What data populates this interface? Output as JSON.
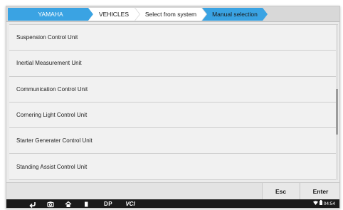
{
  "breadcrumb": {
    "items": [
      "YAMAHA",
      "VEHICLES",
      "Select from system",
      "Manual selection"
    ]
  },
  "list": {
    "items": [
      "Suspension Control Unit",
      "Inertial Measurement Unit",
      "Communication Control Unit",
      "Cornering Light Control Unit",
      "Starter Generater Control Unit",
      "Standing Assist Control Unit"
    ]
  },
  "actions": {
    "esc_label": "Esc",
    "enter_label": "Enter"
  },
  "navbar": {
    "dp_label": "DP",
    "vci_label": "VCI",
    "back_icon": "back-arrow-icon",
    "camera_icon": "camera-icon",
    "home_icon": "home-icon",
    "recents_icon": "recents-icon"
  },
  "status": {
    "time": "04:54",
    "wifi_icon": "wifi-icon",
    "battery_icon": "battery-icon"
  },
  "colors": {
    "accent": "#3aa3e3",
    "navbar": "#1a1a1a"
  }
}
